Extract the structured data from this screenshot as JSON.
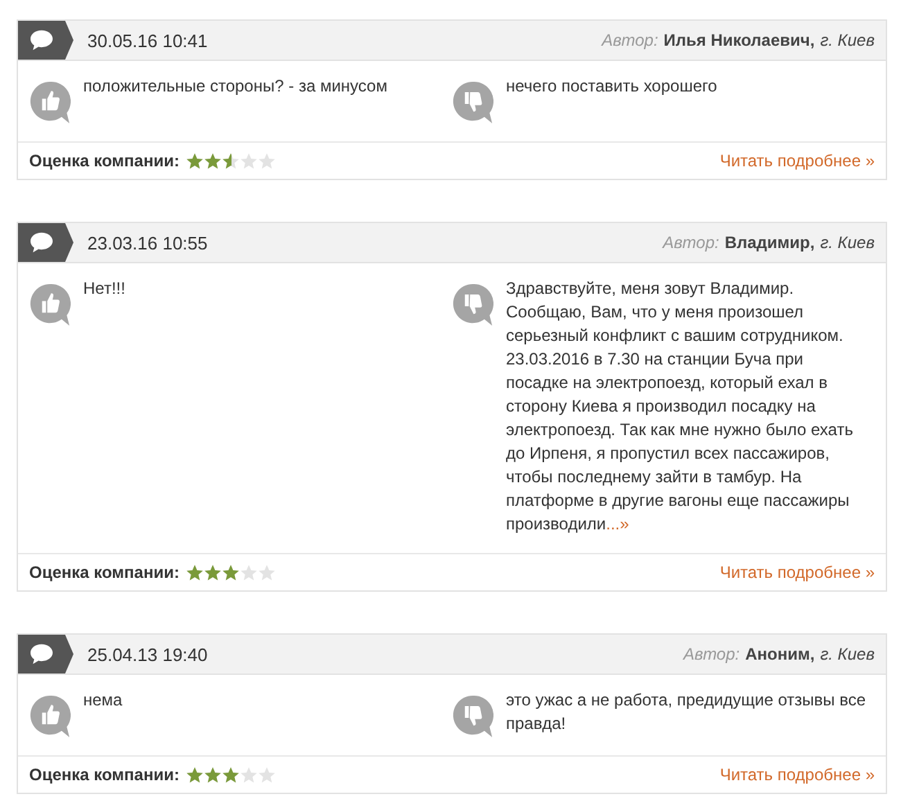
{
  "reviews": [
    {
      "date": "30.05.16 10:41",
      "author_label": "Автор:",
      "author_name": "Илья Николаевич,",
      "city": "г. Киев",
      "pros": "положительные стороны? - за минусом",
      "cons": "нечего поставить хорошего",
      "rating_label": "Оценка компании:",
      "stars": 2.5,
      "read_more": "Читать подробнее »"
    },
    {
      "date": "23.03.16 10:55",
      "author_label": "Автор:",
      "author_name": "Владимир,",
      "city": "г. Киев",
      "pros": "Нет!!!",
      "cons": "Здравствуйте, меня зовут Владимир. Сообщаю, Вам, что у меня произошел серьезный конфликт с вашим сотрудником. 23.03.2016 в 7.30 на станции Буча при посадке на электропоезд, который ехал в сторону Киева я производил посадку на электропоезд. Так как мне нужно было ехать до Ирпеня, я пропустил всех пассажиров, чтобы последнему зайти в тамбур. На платформе в другие вагоны еще пассажиры производили",
      "cons_more": "...»",
      "rating_label": "Оценка компании:",
      "stars": 3,
      "read_more": "Читать подробнее »"
    },
    {
      "date": "25.04.13 19:40",
      "author_label": "Автор:",
      "author_name": "Аноним,",
      "city": "г. Киев",
      "pros": "нема",
      "cons": "это ужас а не работа, предидущие отзывы все правда!",
      "rating_label": "Оценка компании:",
      "stars": 3,
      "read_more": "Читать подробнее »"
    }
  ]
}
